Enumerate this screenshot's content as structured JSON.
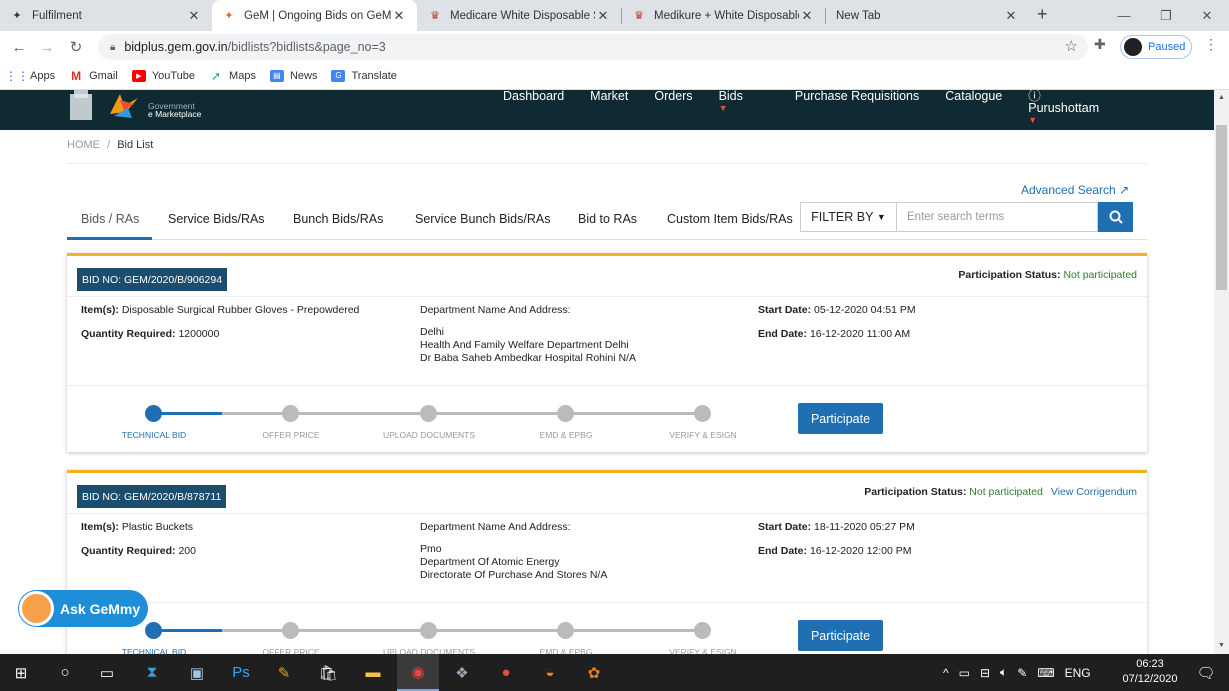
{
  "browser": {
    "tabs": [
      {
        "title": "Fulfilment",
        "icon": "gem-favicon"
      },
      {
        "title": "GeM | Ongoing Bids on GeM",
        "icon": "gem-favicon"
      },
      {
        "title": "Medicare White Disposable Sur",
        "icon": "product-favicon"
      },
      {
        "title": "Medikure + White Disposable",
        "icon": "product-favicon"
      },
      {
        "title": "New Tab",
        "icon": ""
      }
    ],
    "url_host": "bidplus.gem.gov.in",
    "url_path": "/bidlists?bidlists&page_no=3",
    "profile_label": "Paused",
    "bookmarks": [
      {
        "label": "Apps",
        "icon": "apps-grid-icon"
      },
      {
        "label": "Gmail",
        "icon": "gmail-icon"
      },
      {
        "label": "YouTube",
        "icon": "youtube-icon"
      },
      {
        "label": "Maps",
        "icon": "maps-icon"
      },
      {
        "label": "News",
        "icon": "news-icon"
      },
      {
        "label": "Translate",
        "icon": "translate-icon"
      }
    ]
  },
  "gem": {
    "logo_line1": "Government",
    "logo_line2": "e Marketplace",
    "nav": [
      "Dashboard",
      "Market",
      "Orders",
      "Bids",
      "Purchase Requisitions",
      "Catalogue"
    ],
    "user": "Purushottam",
    "breadcrumb_home": "HOME",
    "breadcrumb_sep": "/",
    "breadcrumb_current": "Bid List",
    "advanced_search": "Advanced Search",
    "tabs": [
      "Bids / RAs",
      "Service Bids/RAs",
      "Bunch Bids/RAs",
      "Service Bunch Bids/RAs",
      "Bid to RAs",
      "Custom Item Bids/RAs"
    ],
    "filter_label": "FILTER BY",
    "search_placeholder": "Enter search terms"
  },
  "labels": {
    "items": "Item(s):",
    "quantity": "Quantity Required:",
    "dept": "Department Name And Address:",
    "start": "Start Date:",
    "end": "End Date:",
    "status": "Participation Status:",
    "participate": "Participate",
    "steps": [
      "TECHNICAL BID",
      "OFFER PRICE",
      "UPLOAD DOCUMENTS",
      "EMD & EPBG",
      "VERIFY & ESIGN"
    ]
  },
  "bids": [
    {
      "bid_no": "BID NO: GEM/2020/B/906294",
      "status": "Not participated",
      "corrigendum": "",
      "item": "Disposable Surgical Rubber Gloves - Prepowdered",
      "quantity": "1200000",
      "dept1": "Delhi",
      "dept2": "Health And Family Welfare Department Delhi",
      "dept3": "Dr Baba Saheb Ambedkar Hospital Rohini N/A",
      "start": "05-12-2020 04:51 PM",
      "end": "16-12-2020 11:00 AM"
    },
    {
      "bid_no": "BID NO: GEM/2020/B/878711",
      "status": "Not participated",
      "corrigendum": "View Corrigendum",
      "item": "Plastic Buckets",
      "quantity": "200",
      "dept1": "Pmo",
      "dept2": "Department Of Atomic Energy",
      "dept3": "Directorate Of Purchase And Stores N/A",
      "start": "18-11-2020 05:27 PM",
      "end": "16-12-2020 12:00 PM"
    }
  ],
  "chat": {
    "label": "Ask GeMmy"
  },
  "taskbar": {
    "lang": "ENG",
    "time": "06:23",
    "date": "07/12/2020"
  }
}
